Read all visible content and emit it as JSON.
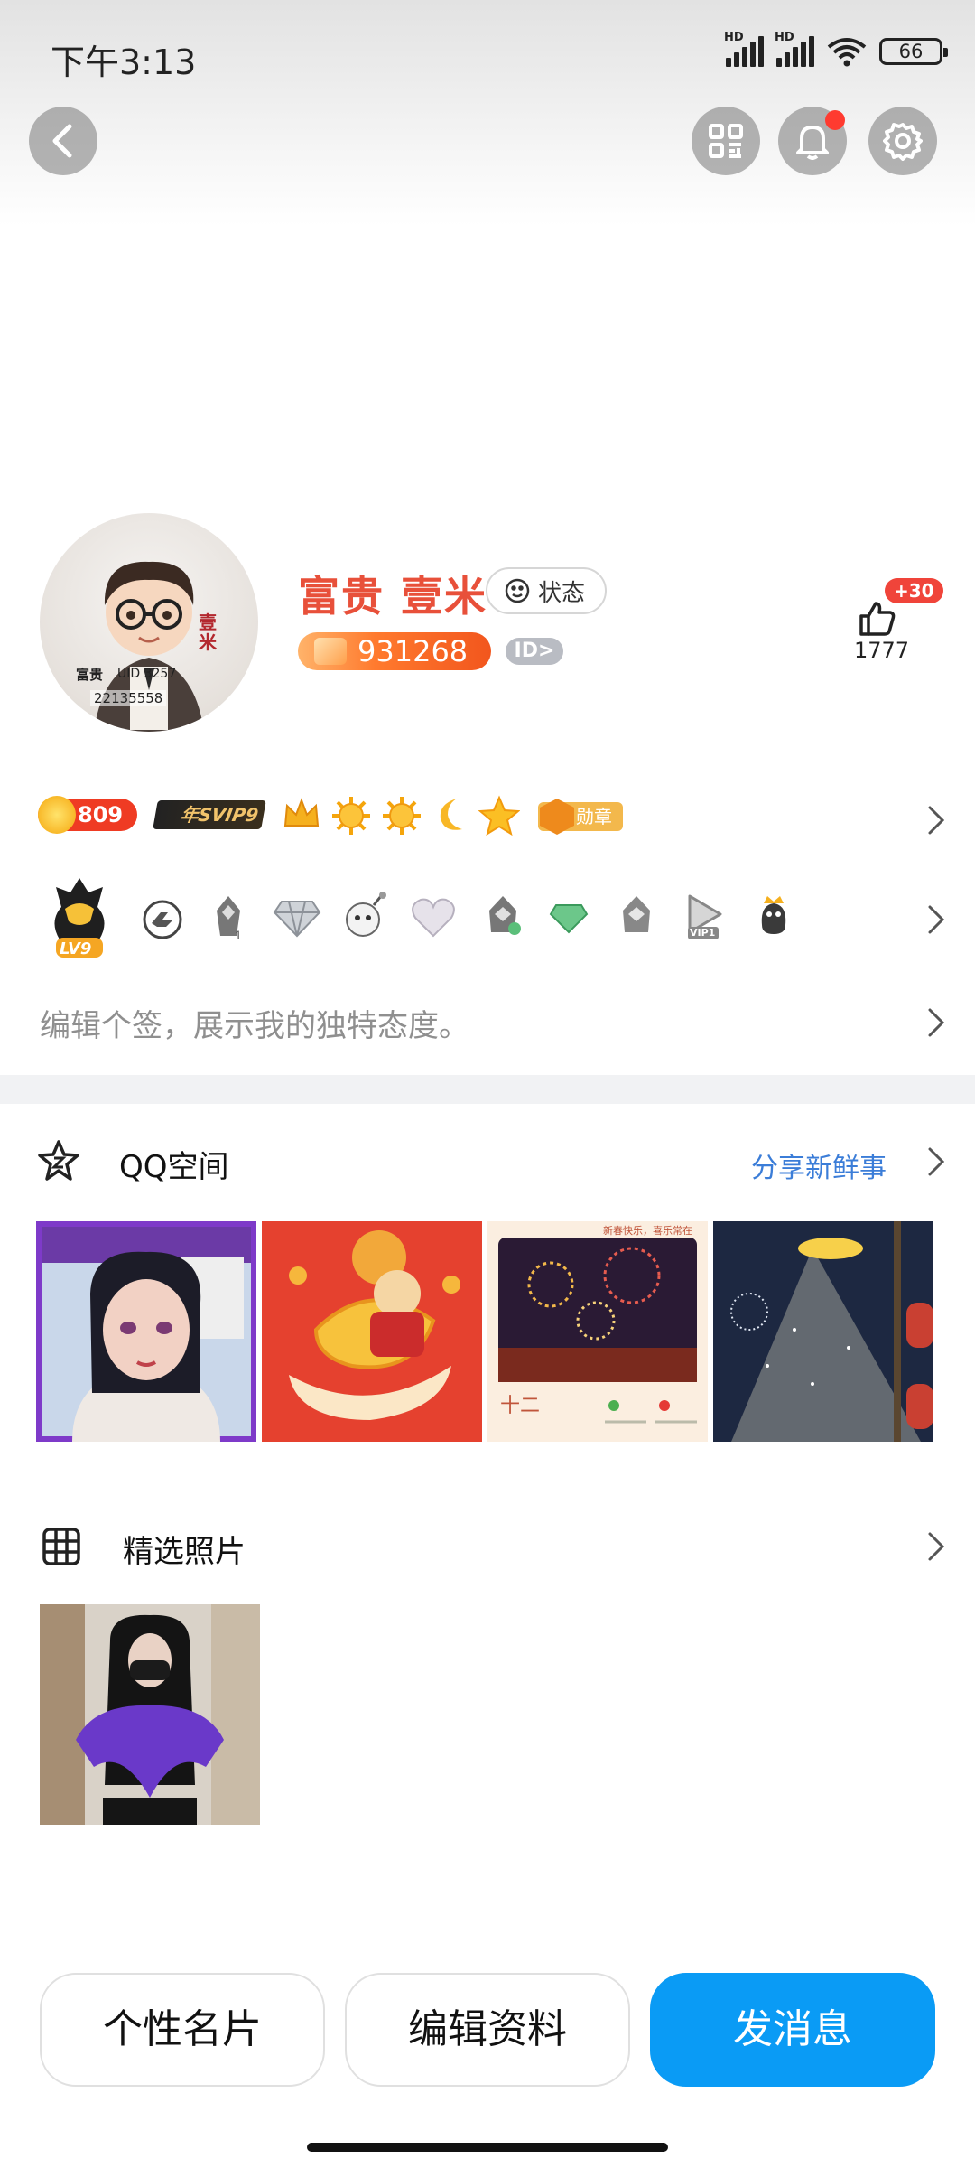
{
  "status_bar": {
    "time": "下午3:13",
    "battery": "66",
    "signal_labels": [
      "HD",
      "HD"
    ]
  },
  "profile": {
    "nickname": "富贵 壹米",
    "status_label": "状态",
    "qq_number": "931268",
    "id_tag": "ID>",
    "like_plus": "+30",
    "like_count": "1777",
    "avatar_text": {
      "line1": "富贵",
      "uid": "UID 3257",
      "qq": "22135558",
      "seal": "壹米"
    }
  },
  "badges": {
    "level_points": "809",
    "svip": "年SVIP9",
    "medal": "勋章"
  },
  "lv_badge": "LV9",
  "vip_badge": "VIP1",
  "signature_placeholder": "编辑个签，展示我的独特态度。",
  "qzone": {
    "title": "QQ空间",
    "share_link": "分享新鲜事",
    "thumb3_text": {
      "top": "新春快乐，喜乐常在",
      "date": "十二"
    }
  },
  "photos": {
    "title": "精选照片"
  },
  "actions": {
    "card": "个性名片",
    "edit": "编辑资料",
    "message": "发消息"
  },
  "colors": {
    "accent_blue": "#0a9bf5",
    "name_red": "#e8503a",
    "link_blue": "#3b7dd8"
  }
}
